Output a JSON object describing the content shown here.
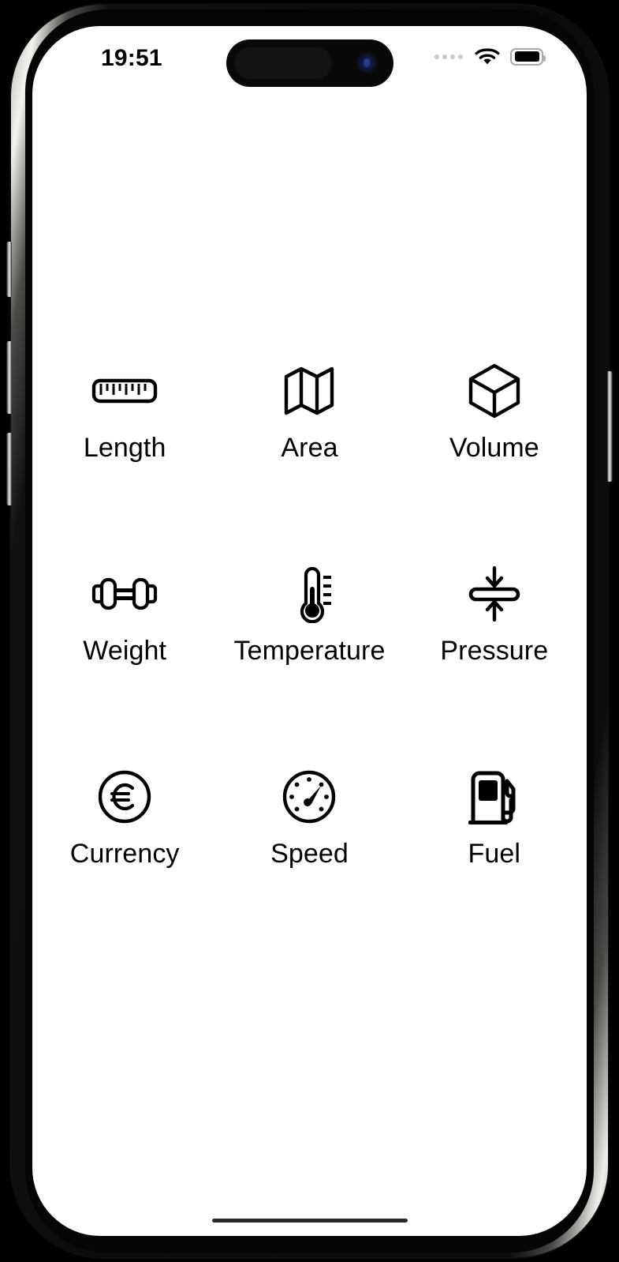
{
  "device": {
    "type": "smartphone",
    "frame_color": "#0a0a0a",
    "bezel_color": "#efeee8",
    "screen_background": "#ffffff"
  },
  "status_bar": {
    "time": "19:51",
    "signal_icon": "signal-dots-icon",
    "wifi_icon": "wifi-icon",
    "battery_icon": "battery-full-icon",
    "dynamic_island": "dynamic-island",
    "camera": "front-camera"
  },
  "app": {
    "accent_color": "#000000",
    "grid": {
      "columns": 3,
      "items": [
        {
          "id": "length",
          "label": "Length",
          "icon": "ruler-icon"
        },
        {
          "id": "area",
          "label": "Area",
          "icon": "map-icon"
        },
        {
          "id": "volume",
          "label": "Volume",
          "icon": "cube-icon"
        },
        {
          "id": "weight",
          "label": "Weight",
          "icon": "dumbbell-icon"
        },
        {
          "id": "temperature",
          "label": "Temperature",
          "icon": "thermometer-icon"
        },
        {
          "id": "pressure",
          "label": "Pressure",
          "icon": "compress-arrows-icon"
        },
        {
          "id": "currency",
          "label": "Currency",
          "icon": "euro-circle-icon"
        },
        {
          "id": "speed",
          "label": "Speed",
          "icon": "speedometer-icon"
        },
        {
          "id": "fuel",
          "label": "Fuel",
          "icon": "gas-pump-icon"
        }
      ]
    }
  },
  "home_indicator": {
    "visible": true
  }
}
